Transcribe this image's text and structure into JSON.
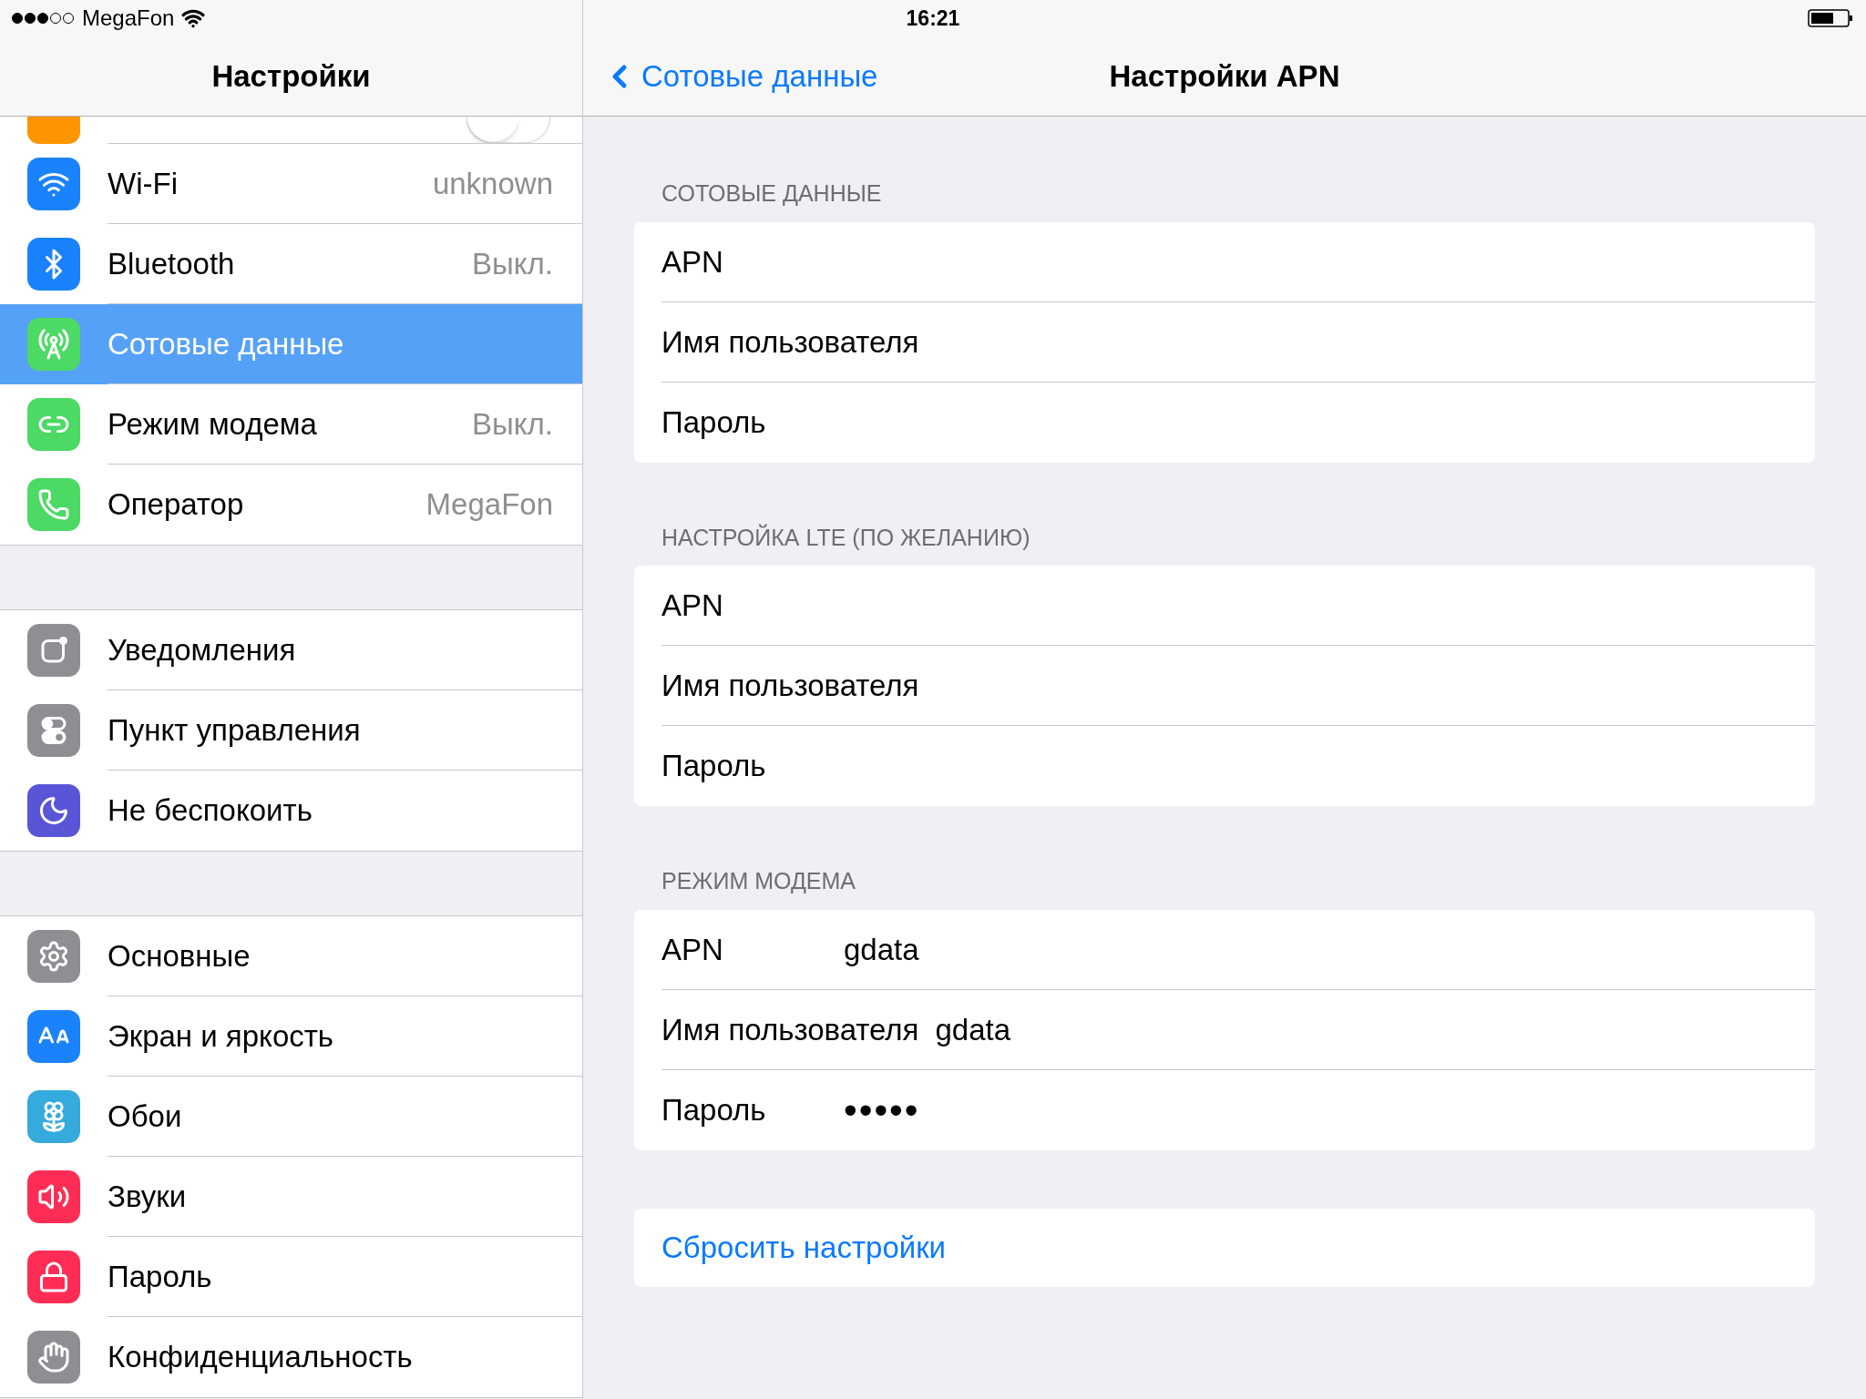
{
  "status_bar": {
    "carrier": "MegaFon",
    "time": "16:21"
  },
  "sidebar": {
    "title": "Настройки",
    "groups": [
      {
        "items": [
          {
            "kind": "toggle",
            "on": false
          },
          {
            "kind": "link",
            "label": "Wi-Fi",
            "value": "unknown",
            "selected": false
          },
          {
            "kind": "link",
            "label": "Bluetooth",
            "value": "Выкл.",
            "selected": false
          },
          {
            "kind": "link",
            "label": "Сотовые данные",
            "selected": true
          },
          {
            "kind": "link",
            "label": "Режим модема",
            "value": "Выкл.",
            "selected": false
          },
          {
            "kind": "link",
            "label": "Оператор",
            "value": "MegaFon",
            "selected": false
          }
        ]
      },
      {
        "items": [
          {
            "kind": "link",
            "label": "Уведомления",
            "selected": false
          },
          {
            "kind": "link",
            "label": "Пункт управления",
            "selected": false
          },
          {
            "kind": "link",
            "label": "Не беспокоить",
            "selected": false
          }
        ]
      },
      {
        "items": [
          {
            "kind": "link",
            "label": "Основные",
            "selected": false
          },
          {
            "kind": "link",
            "label": "Экран и яркость",
            "selected": false
          },
          {
            "kind": "link",
            "label": "Обои",
            "selected": false
          },
          {
            "kind": "link",
            "label": "Звуки",
            "selected": false
          },
          {
            "kind": "link",
            "label": "Пароль",
            "selected": false
          },
          {
            "kind": "link",
            "label": "Конфиденциальность",
            "selected": false
          }
        ]
      }
    ]
  },
  "detail": {
    "back": "Сотовые данные",
    "title": "Настройки APN",
    "sections": [
      {
        "header": "СОТОВЫЕ ДАННЫЕ",
        "fields": [
          {
            "label": "APN"
          },
          {
            "label": "Имя пользователя"
          },
          {
            "label": "Пароль"
          }
        ]
      },
      {
        "header": "НАСТРОЙКА LTE (ПО ЖЕЛАНИЮ)",
        "fields": [
          {
            "label": "APN"
          },
          {
            "label": "Имя пользователя"
          },
          {
            "label": "Пароль"
          }
        ]
      },
      {
        "header": "РЕЖИМ МОДЕМА",
        "fields": [
          {
            "label": "APN",
            "value": "gdata"
          },
          {
            "label": "Имя пользователя",
            "value": "gdata"
          },
          {
            "label": "Пароль",
            "value": "•••••"
          }
        ]
      }
    ],
    "reset_button": "Сбросить настройки"
  }
}
